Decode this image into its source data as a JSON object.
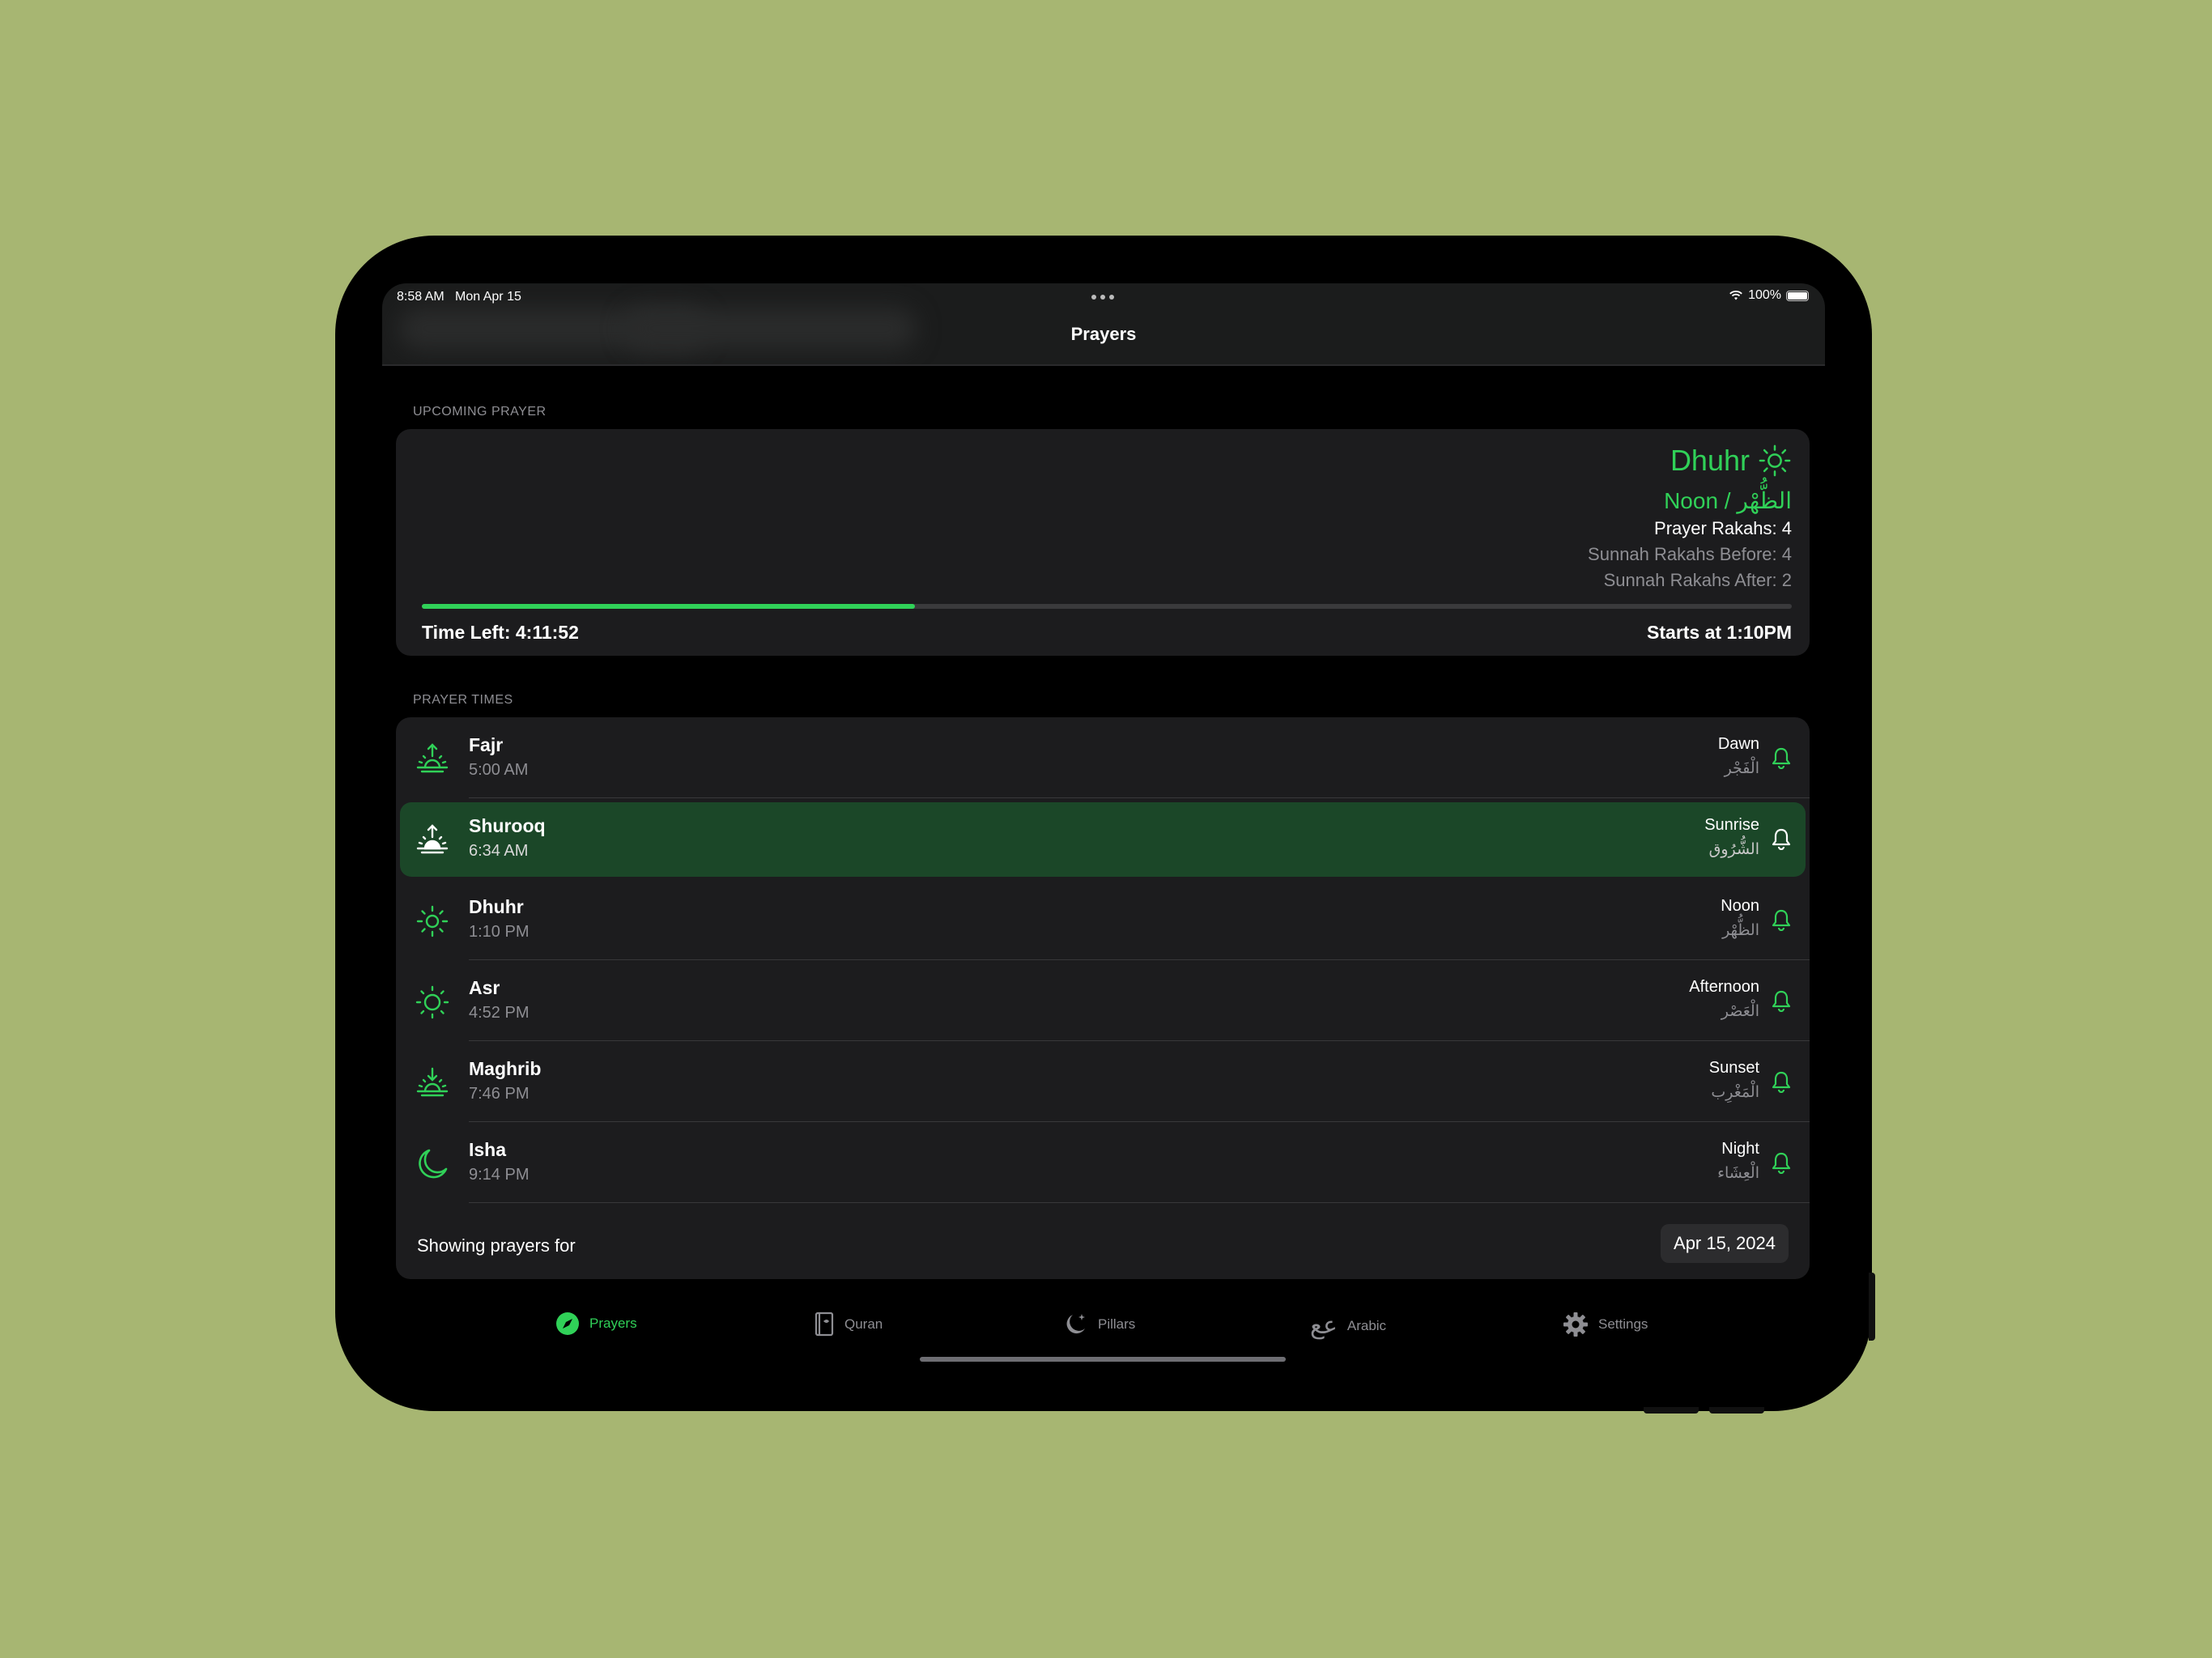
{
  "status_bar": {
    "time": "8:58 AM",
    "date": "Mon Apr 15",
    "battery": "100%"
  },
  "nav": {
    "title": "Prayers"
  },
  "upcoming": {
    "section_label": "UPCOMING PRAYER",
    "name": "Dhuhr",
    "subtitle": "Noon / الظُّهْر",
    "prayer_rakahs": "Prayer Rakahs: 4",
    "sunnah_before": "Sunnah Rakahs Before: 4",
    "sunnah_after": "Sunnah Rakahs After: 2",
    "progress": 0.36,
    "time_left": "Time Left: 4:11:52",
    "starts_at": "Starts at 1:10PM"
  },
  "prayer_times": {
    "section_label": "PRAYER TIMES",
    "rows": [
      {
        "name": "Fajr",
        "time": "5:00 AM",
        "english": "Dawn",
        "arabic": "الْفَجْر",
        "icon": "sunrise-icon"
      },
      {
        "name": "Shurooq",
        "time": "6:34 AM",
        "english": "Sunrise",
        "arabic": "الشُّرُوق",
        "icon": "sunrise-icon"
      },
      {
        "name": "Dhuhr",
        "time": "1:10 PM",
        "english": "Noon",
        "arabic": "الظُّهْر",
        "icon": "sun-icon"
      },
      {
        "name": "Asr",
        "time": "4:52 PM",
        "english": "Afternoon",
        "arabic": "الْعَصْر",
        "icon": "sun-icon"
      },
      {
        "name": "Maghrib",
        "time": "7:46 PM",
        "english": "Sunset",
        "arabic": "الْمَغْرِب",
        "icon": "sunset-icon"
      },
      {
        "name": "Isha",
        "time": "9:14 PM",
        "english": "Night",
        "arabic": "الْعِشَاء",
        "icon": "moon-icon"
      }
    ],
    "footer_label": "Showing prayers for",
    "date": "Apr 15, 2024"
  },
  "tabs": [
    {
      "label": "Prayers",
      "icon": "compass-icon",
      "active": true
    },
    {
      "label": "Quran",
      "icon": "book-icon",
      "active": false
    },
    {
      "label": "Pillars",
      "icon": "moon-stars-icon",
      "active": false
    },
    {
      "label": "Arabic",
      "icon": "arabic-letters-icon",
      "active": false
    },
    {
      "label": "Settings",
      "icon": "gear-icon",
      "active": false
    }
  ],
  "colors": {
    "accent": "#30d158",
    "background": "#a7b672",
    "active_row": "#1b4728",
    "card": "#1c1c1e"
  }
}
